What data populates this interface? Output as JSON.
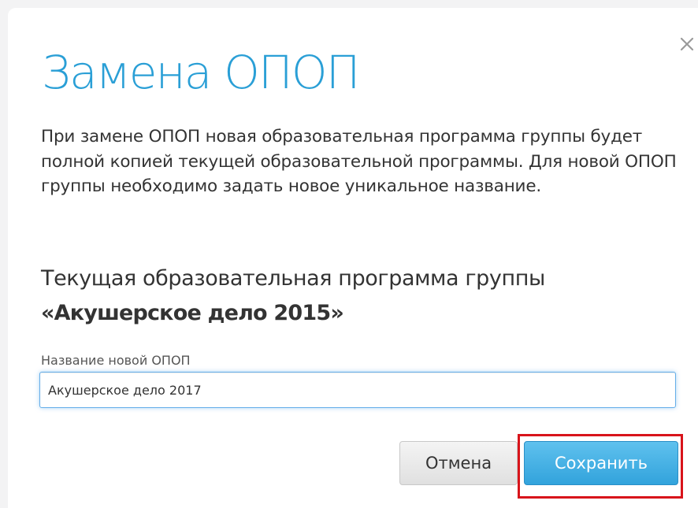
{
  "dialog": {
    "title": "Замена ОПОП",
    "close_icon": "close-icon",
    "description": "При замене ОПОП новая образовательная программа группы будет полной копией текущей образовательной программы. Для новой ОПОП группы необходимо задать новое уникальное название.",
    "current_program_label": "Текущая образовательная программа группы",
    "current_program_name": "«Акушерское дело 2015»",
    "new_name_field": {
      "label": "Название новой ОПОП",
      "value": "Акушерское дело 2017"
    },
    "buttons": {
      "cancel_label": "Отмена",
      "save_label": "Сохранить"
    }
  },
  "colors": {
    "accent": "#2a9fd6",
    "save_button": "#3fb0e4",
    "highlight_border": "#d8141b",
    "text": "#333333"
  }
}
